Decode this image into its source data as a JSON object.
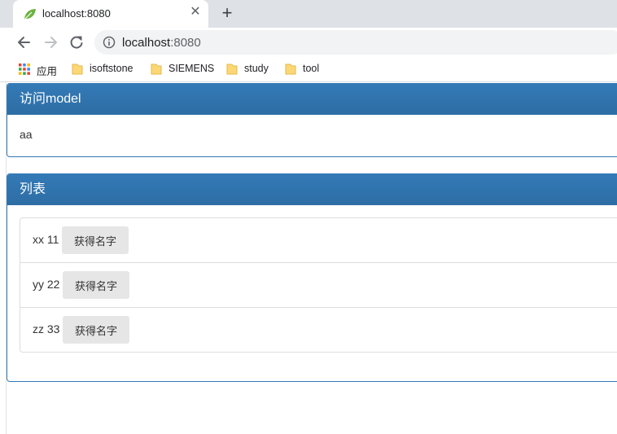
{
  "browser": {
    "tab_title": "localhost:8080",
    "url_host": "localhost",
    "url_port": ":8080",
    "bookmarks": [
      {
        "label": "应用",
        "icon": "apps-grid-icon"
      },
      {
        "label": "isoftstone",
        "icon": "folder-icon"
      },
      {
        "label": "SIEMENS",
        "icon": "folder-icon"
      },
      {
        "label": "study",
        "icon": "folder-icon"
      },
      {
        "label": "tool",
        "icon": "folder-icon"
      }
    ]
  },
  "model_panel": {
    "title": "访问model",
    "value": "aa"
  },
  "list_panel": {
    "title": "列表",
    "items": [
      {
        "text": "xx 11",
        "button_label": "获得名字"
      },
      {
        "text": "yy 22",
        "button_label": "获得名字"
      },
      {
        "text": "zz 33",
        "button_label": "获得名字"
      }
    ]
  },
  "colors": {
    "panel_primary": "#337ab7",
    "tabstrip_bg": "#dee1e6",
    "button_bg": "#e6e6e6"
  }
}
